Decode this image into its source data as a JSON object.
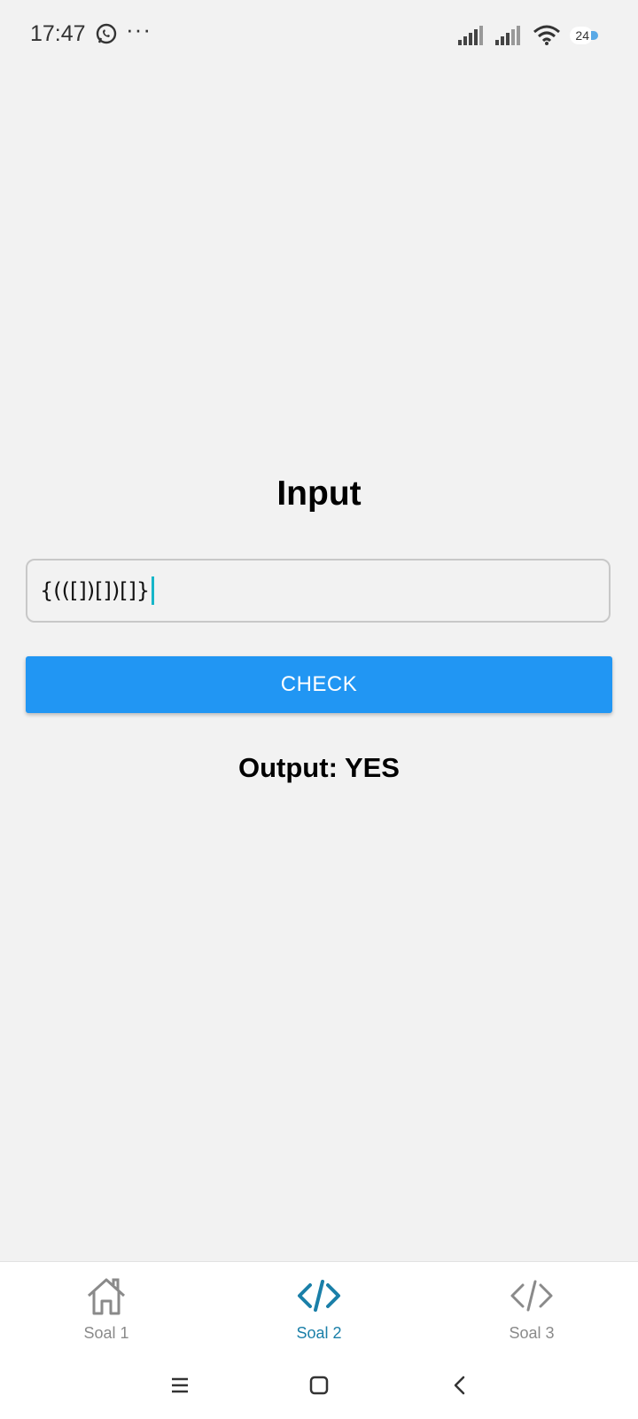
{
  "status_bar": {
    "time": "17:47",
    "more": "···",
    "battery": "24",
    "icons": [
      "whatsapp-icon",
      "signal-icon",
      "signal-icon",
      "wifi-icon",
      "battery-icon"
    ]
  },
  "main": {
    "title": "Input",
    "input_value": "{(([])[])[]}",
    "check_label": "CHECK",
    "output": "Output: YES"
  },
  "bottom_nav": {
    "items": [
      {
        "label": "Soal 1",
        "icon": "home-icon",
        "active": false
      },
      {
        "label": "Soal 2",
        "icon": "code-icon",
        "active": true
      },
      {
        "label": "Soal 3",
        "icon": "code-icon",
        "active": false
      }
    ]
  },
  "system_nav": {
    "icons": [
      "menu-icon",
      "home-square-icon",
      "back-icon"
    ]
  },
  "colors": {
    "background": "#f2f2f2",
    "button": "#2196f3",
    "active_tab": "#1a7fa8",
    "inactive_tab": "#8a8a8a",
    "caret": "#17b6c9"
  }
}
